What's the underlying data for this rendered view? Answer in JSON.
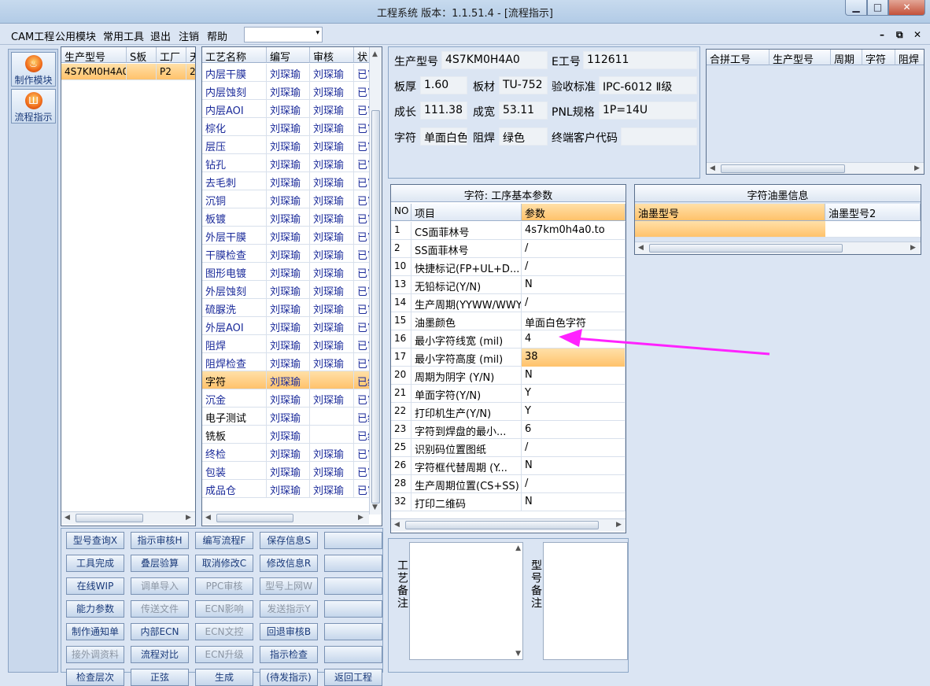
{
  "window": {
    "title": "工程系统   版本：1.1.51.4 - [流程指示]",
    "min": "▁",
    "max": "□",
    "close": "✕"
  },
  "menu": {
    "items": [
      "CAM工程",
      "公用模块",
      "常用工具",
      "退出",
      "注销",
      "帮助"
    ],
    "combo_arrow": "▾",
    "mdi": [
      "–",
      "⧉",
      "✕"
    ]
  },
  "nav": {
    "buttons": [
      "制作模块",
      "流程指示"
    ]
  },
  "model_grid": {
    "headers": [
      "生产型号",
      "S板",
      "工厂",
      "天"
    ],
    "rows": [
      [
        "4S7KM0H4A0",
        "",
        "P2",
        "2"
      ]
    ]
  },
  "process_grid": {
    "headers": [
      "工艺名称",
      "编写",
      "审核",
      "状"
    ],
    "rows": [
      [
        "内层干膜",
        "刘琛瑜",
        "刘琛瑜",
        "已审"
      ],
      [
        "内层蚀刻",
        "刘琛瑜",
        "刘琛瑜",
        "已审"
      ],
      [
        "内层AOI",
        "刘琛瑜",
        "刘琛瑜",
        "已审"
      ],
      [
        "棕化",
        "刘琛瑜",
        "刘琛瑜",
        "已审"
      ],
      [
        "层压",
        "刘琛瑜",
        "刘琛瑜",
        "已审"
      ],
      [
        "钻孔",
        "刘琛瑜",
        "刘琛瑜",
        "已审"
      ],
      [
        "去毛刺",
        "刘琛瑜",
        "刘琛瑜",
        "已审"
      ],
      [
        "沉铜",
        "刘琛瑜",
        "刘琛瑜",
        "已审"
      ],
      [
        "板镀",
        "刘琛瑜",
        "刘琛瑜",
        "已审"
      ],
      [
        "外层干膜",
        "刘琛瑜",
        "刘琛瑜",
        "已审"
      ],
      [
        "干膜检查",
        "刘琛瑜",
        "刘琛瑜",
        "已审"
      ],
      [
        "图形电镀",
        "刘琛瑜",
        "刘琛瑜",
        "已审"
      ],
      [
        "外层蚀刻",
        "刘琛瑜",
        "刘琛瑜",
        "已审"
      ],
      [
        "硫脲洗",
        "刘琛瑜",
        "刘琛瑜",
        "已审"
      ],
      [
        "外层AOI",
        "刘琛瑜",
        "刘琛瑜",
        "已审"
      ],
      [
        "阻焊",
        "刘琛瑜",
        "刘琛瑜",
        "已审"
      ],
      [
        "阻焊检查",
        "刘琛瑜",
        "刘琛瑜",
        "已审"
      ],
      [
        "字符",
        "刘琛瑜",
        "",
        "已编"
      ],
      [
        "沉金",
        "刘琛瑜",
        "刘琛瑜",
        "已审"
      ],
      [
        "电子测试",
        "刘琛瑜",
        "",
        "已编"
      ],
      [
        "铣板",
        "刘琛瑜",
        "",
        "已编"
      ],
      [
        "终检",
        "刘琛瑜",
        "刘琛瑜",
        "已审"
      ],
      [
        "包装",
        "刘琛瑜",
        "刘琛瑜",
        "已审"
      ],
      [
        "成品仓",
        "刘琛瑜",
        "刘琛瑜",
        "已审"
      ]
    ],
    "selected_index": 17
  },
  "info": {
    "model_label": "生产型号",
    "model": "4S7KM0H4A0",
    "e_label": "E工号",
    "e_no": "112611",
    "thick_label": "板厚",
    "thick": "1.60",
    "material_label": "板材",
    "material": "TU-752",
    "accept_label": "验收标准",
    "accept": "IPC-6012 Ⅱ级",
    "len_label": "成长",
    "len": "111.38",
    "width_label": "成宽",
    "width": "53.11",
    "pnl_label": "PNL规格",
    "pnl": "1P=14U",
    "char_label": "字符",
    "char": "单面白色",
    "mask_label": "阻焊",
    "mask": "绿色",
    "customer_label": "终端客户代码",
    "customer": ""
  },
  "merge_grid": {
    "headers": [
      "合拼工号",
      "生产型号",
      "周期",
      "字符",
      "阻焊"
    ]
  },
  "params": {
    "title": "字符: 工序基本参数",
    "headers": [
      "NO",
      "项目",
      "参数"
    ],
    "rows": [
      [
        "1",
        "CS面菲林号",
        "4s7km0h4a0.to"
      ],
      [
        "2",
        "SS面菲林号",
        "/"
      ],
      [
        "10",
        "快捷标记(FP+UL+D...",
        "/"
      ],
      [
        "13",
        "无铅标记(Y/N)",
        "N"
      ],
      [
        "14",
        "生产周期(YYWW/WWYY)",
        "/"
      ],
      [
        "15",
        "油墨颜色",
        "单面白色字符"
      ],
      [
        "16",
        "最小字符线宽 (mil)",
        "4"
      ],
      [
        "17",
        "最小字符高度 (mil)",
        "38"
      ],
      [
        "20",
        "周期为阴字 (Y/N)",
        "N"
      ],
      [
        "21",
        "单面字符(Y/N)",
        "Y"
      ],
      [
        "22",
        "打印机生产(Y/N)",
        "Y"
      ],
      [
        "23",
        "字符到焊盘的最小...",
        "6"
      ],
      [
        "25",
        "识别码位置图纸",
        "/"
      ],
      [
        "26",
        "字符框代替周期 (Y...",
        "N"
      ],
      [
        "28",
        "生产周期位置(CS+SS)",
        "/"
      ],
      [
        "32",
        "打印二维码",
        "N"
      ]
    ],
    "selected_index": 7
  },
  "ink": {
    "title": "字符油墨信息",
    "headers": [
      "油墨型号",
      "油墨型号2"
    ]
  },
  "notes": {
    "process_label": "工艺备注",
    "model_label": "型号备注"
  },
  "buttons": [
    [
      "型号查询X",
      "指示审核H",
      "编写流程F",
      "保存信息S",
      ""
    ],
    [
      "工具完成",
      "叠层验算",
      "取消修改C",
      "修改信息R",
      ""
    ],
    [
      "在线WIP",
      "调单导入",
      "PPC审核",
      "型号上网W",
      ""
    ],
    [
      "能力参数",
      "传送文件",
      "ECN影响",
      "发送指示Y",
      ""
    ],
    [
      "制作通知单",
      "内部ECN",
      "ECN文控",
      "回退审核B",
      ""
    ],
    [
      "接外调资料",
      "流程对比",
      "ECN升级",
      "指示检查",
      ""
    ],
    [
      "检查层次",
      "正弦",
      "生成",
      "(待发指示)",
      "返回工程"
    ]
  ],
  "disabled_buttons": [
    "调单导入",
    "PPC审核",
    "型号上网W",
    "传送文件",
    "ECN影响",
    "发送指示Y",
    "ECN文控",
    "接外调资料",
    "ECN升级"
  ],
  "annotation": {
    "color": "#ff22ff"
  }
}
